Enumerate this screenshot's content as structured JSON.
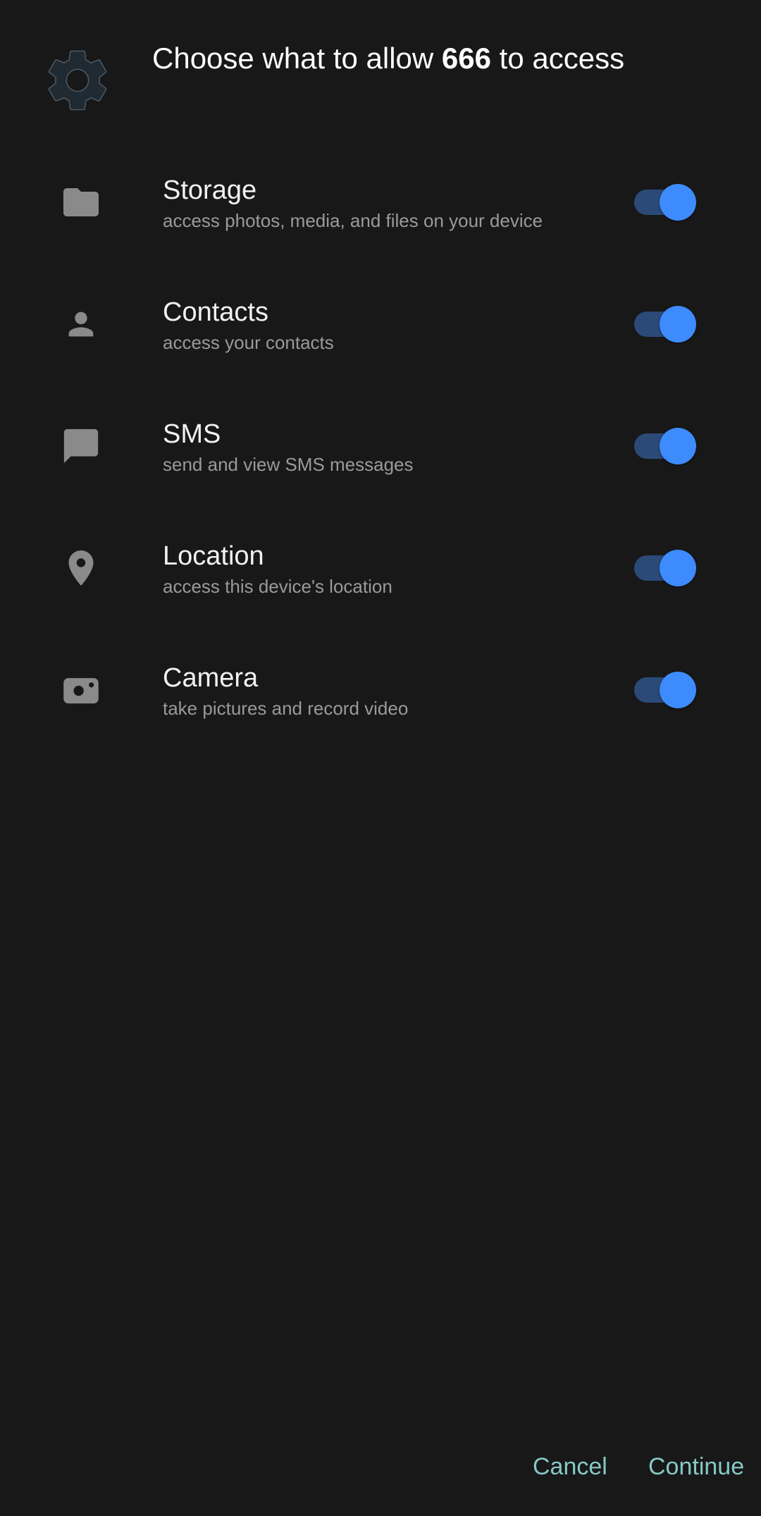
{
  "header": {
    "title_prefix": "Choose what to allow ",
    "app_name": "666",
    "title_suffix": " to access",
    "app_icon": "gear-icon"
  },
  "permissions": [
    {
      "icon": "folder-icon",
      "name": "Storage",
      "description": "access photos, media, and files on your device",
      "enabled": true
    },
    {
      "icon": "person-icon",
      "name": "Contacts",
      "description": "access your contacts",
      "enabled": true
    },
    {
      "icon": "message-icon",
      "name": "SMS",
      "description": "send and view SMS messages",
      "enabled": true
    },
    {
      "icon": "location-pin-icon",
      "name": "Location",
      "description": "access this device's location",
      "enabled": true
    },
    {
      "icon": "camera-icon",
      "name": "Camera",
      "description": "take pictures and record video",
      "enabled": true
    }
  ],
  "actions": {
    "cancel_label": "Cancel",
    "continue_label": "Continue"
  },
  "colors": {
    "background": "#181818",
    "toggle_on": "#3d8bfd",
    "toggle_track_on": "#2b4a78",
    "button_text": "#86c9c5",
    "icon_gray": "#8a8a8a"
  }
}
